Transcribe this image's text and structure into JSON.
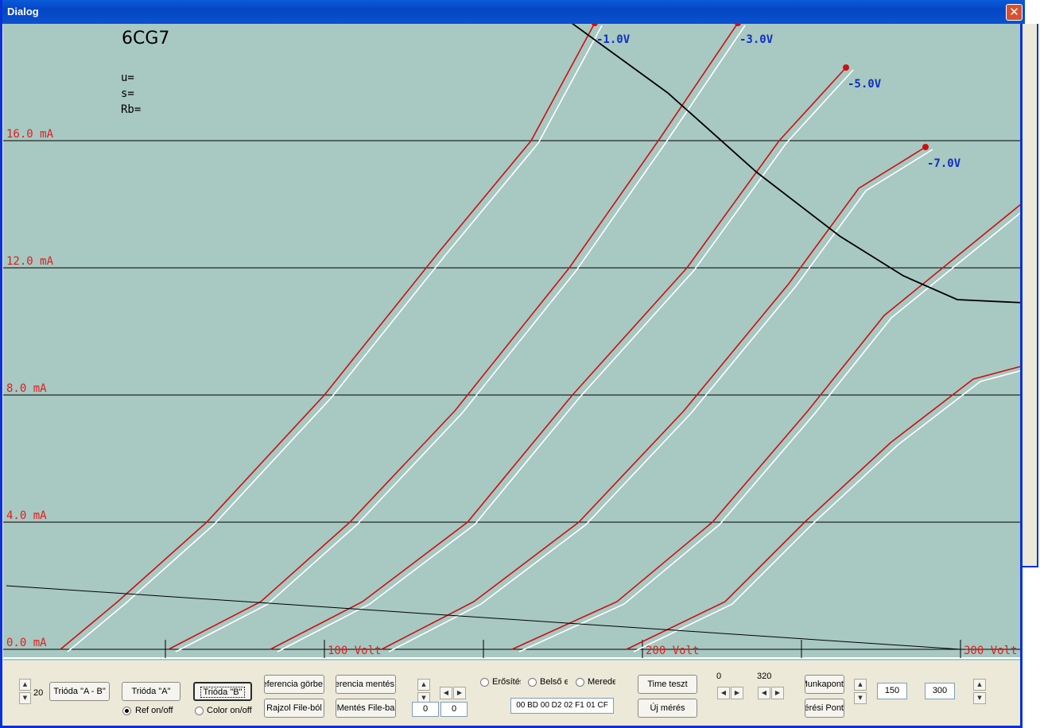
{
  "window": {
    "title": "Dialog",
    "close_glyph": "✕"
  },
  "plot": {
    "tube_name": "6CG7",
    "params": [
      "u=",
      "s=",
      "Rb="
    ],
    "colors": {
      "background": "#a8c8c2",
      "measured": "#cc1010",
      "reference": "#ffffff",
      "label_current": "#dd2020",
      "label_grid": "#1030c0",
      "load_line": "#000000"
    }
  },
  "chart_data": {
    "type": "line",
    "xlabel": "Volt",
    "ylabel": "mA",
    "xlim": [
      0,
      320
    ],
    "ylim": [
      0,
      20
    ],
    "y_ticks": [
      0,
      4,
      8,
      12,
      16
    ],
    "y_tick_labels": [
      "0.0 mA",
      "4.0 mA",
      "8.0 mA",
      "12.0 mA",
      "16.0 mA"
    ],
    "x_ticks": [
      100,
      200,
      300
    ],
    "x_tick_labels": [
      "100 Volt",
      "200 Volt",
      "300 Volt"
    ],
    "grid": true,
    "series": [
      {
        "name": "-1.0V",
        "x": [
          17,
          35,
          63,
          100,
          136,
          165,
          185
        ],
        "y": [
          0,
          1.5,
          4.0,
          8.0,
          12.5,
          16.0,
          19.7
        ]
      },
      {
        "name": "-3.0V",
        "x": [
          51,
          80,
          108,
          141,
          177,
          205,
          230
        ],
        "y": [
          0,
          1.5,
          4.0,
          7.5,
          12.0,
          16.0,
          19.7
        ]
      },
      {
        "name": "-5.0V",
        "x": [
          83,
          112,
          145,
          178,
          214,
          243,
          264
        ],
        "y": [
          0,
          1.5,
          4.0,
          8.0,
          12.0,
          16.0,
          18.3
        ]
      },
      {
        "name": "-7.0V",
        "x": [
          118,
          147,
          180,
          213,
          246,
          268,
          289
        ],
        "y": [
          0,
          1.5,
          4.0,
          7.5,
          11.5,
          14.5,
          15.8
        ]
      },
      {
        "name": "",
        "x": [
          159,
          192,
          222,
          252,
          276,
          319
        ],
        "y": [
          0,
          1.5,
          4.0,
          7.5,
          10.5,
          14.0
        ]
      },
      {
        "name": "",
        "x": [
          195,
          226,
          251,
          278,
          304,
          319
        ],
        "y": [
          0,
          1.5,
          4.0,
          6.5,
          8.5,
          8.9
        ]
      }
    ],
    "max_power_curve": {
      "x": [
        175,
        208,
        236,
        262,
        282,
        299,
        320
      ],
      "y": [
        19.9,
        17.5,
        15.0,
        13.0,
        11.75,
        11.0,
        10.9
      ]
    },
    "load_line": {
      "x": [
        0,
        300
      ],
      "y": [
        2.0,
        0.0
      ]
    }
  },
  "controls": {
    "step_value": "20",
    "trioda_ab": "Trióda \"A - B\"",
    "trioda_a": "Trióda  \"A\"",
    "trioda_b": "Trióda  \"B\"",
    "ref_toggle": "Ref on/off",
    "color_toggle": "Color on/off",
    "ref_curve": "Referencia görbe",
    "draw_file": "Rajzol File-ból",
    "ref_save": "Referencia mentés",
    "save_file": "Mentés File-ba",
    "box1": "0",
    "box2": "0",
    "radio1": "Erősítés",
    "radio2": "Belső ellenállás",
    "radio3": "Meredekség",
    "hex": "00 BD 00 D2 02 F1 01 CF",
    "time_test": "Time teszt",
    "new_meas": "Új mérés",
    "range_min": "0",
    "range_max": "320",
    "work_point": "Munkapont",
    "meas_point": "Mérési Pont",
    "val1": "150",
    "val2": "300"
  }
}
